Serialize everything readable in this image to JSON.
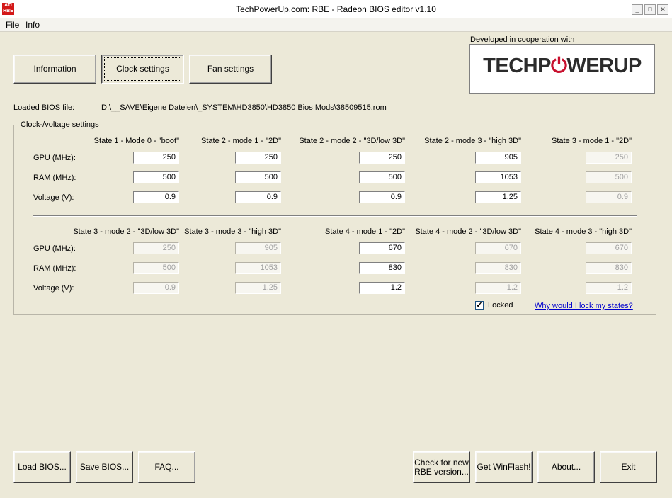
{
  "window": {
    "title": "TechPowerUp.com: RBE - Radeon BIOS editor v1.10",
    "icon_text": "ATI RBE"
  },
  "menu": [
    "File",
    "Info"
  ],
  "tabs": [
    "Information",
    "Clock settings",
    "Fan settings"
  ],
  "logo": {
    "caption": "Developed in cooperation with",
    "text_a": "TECHP",
    "text_b": "WERUP",
    "brand_color": "#c8102e"
  },
  "bios": {
    "label": "Loaded BIOS file:",
    "path": "D:\\__SAVE\\Eigene Dateien\\_SYSTEM\\HD3850\\HD3850 Bios Mods\\38509515.rom"
  },
  "group": {
    "title": "Clock-/voltage settings"
  },
  "row_labels": [
    "GPU (MHz):",
    "RAM (MHz):",
    "Voltage (V):"
  ],
  "states_top": [
    {
      "name": "State 1 - Mode 0 - \"boot\"",
      "gpu": "250",
      "ram": "500",
      "voltage": "0.9",
      "enabled": true
    },
    {
      "name": "State 2 - mode 1 - \"2D\"",
      "gpu": "250",
      "ram": "500",
      "voltage": "0.9",
      "enabled": true
    },
    {
      "name": "State 2 - mode 2 - \"3D/low 3D\"",
      "gpu": "250",
      "ram": "500",
      "voltage": "0.9",
      "enabled": true
    },
    {
      "name": "State 2 - mode 3 - \"high 3D\"",
      "gpu": "905",
      "ram": "1053",
      "voltage": "1.25",
      "enabled": true
    },
    {
      "name": "State 3 - mode 1 - \"2D\"",
      "gpu": "250",
      "ram": "500",
      "voltage": "0.9",
      "enabled": false
    }
  ],
  "states_bottom": [
    {
      "name": "State 3 - mode 2 - \"3D/low 3D\"",
      "gpu": "250",
      "ram": "500",
      "voltage": "0.9",
      "enabled": false
    },
    {
      "name": "State 3 - mode 3 - \"high 3D\"",
      "gpu": "905",
      "ram": "1053",
      "voltage": "1.25",
      "enabled": false
    },
    {
      "name": "State 4 - mode 1 - \"2D\"",
      "gpu": "670",
      "ram": "830",
      "voltage": "1.2",
      "enabled": true
    },
    {
      "name": "State 4 - mode 2 - \"3D/low 3D\"",
      "gpu": "670",
      "ram": "830",
      "voltage": "1.2",
      "enabled": false
    },
    {
      "name": "State 4 - mode 3 - \"high 3D\"",
      "gpu": "670",
      "ram": "830",
      "voltage": "1.2",
      "enabled": false
    }
  ],
  "locked": {
    "label": "Locked",
    "checked": true,
    "check_mark": "✓"
  },
  "lock_link": "Why would I lock my states?",
  "bottom_buttons": [
    "Load BIOS...",
    "Save BIOS...",
    "FAQ...",
    "Check for new RBE version...",
    "Get WinFlash!",
    "About...",
    "Exit"
  ]
}
